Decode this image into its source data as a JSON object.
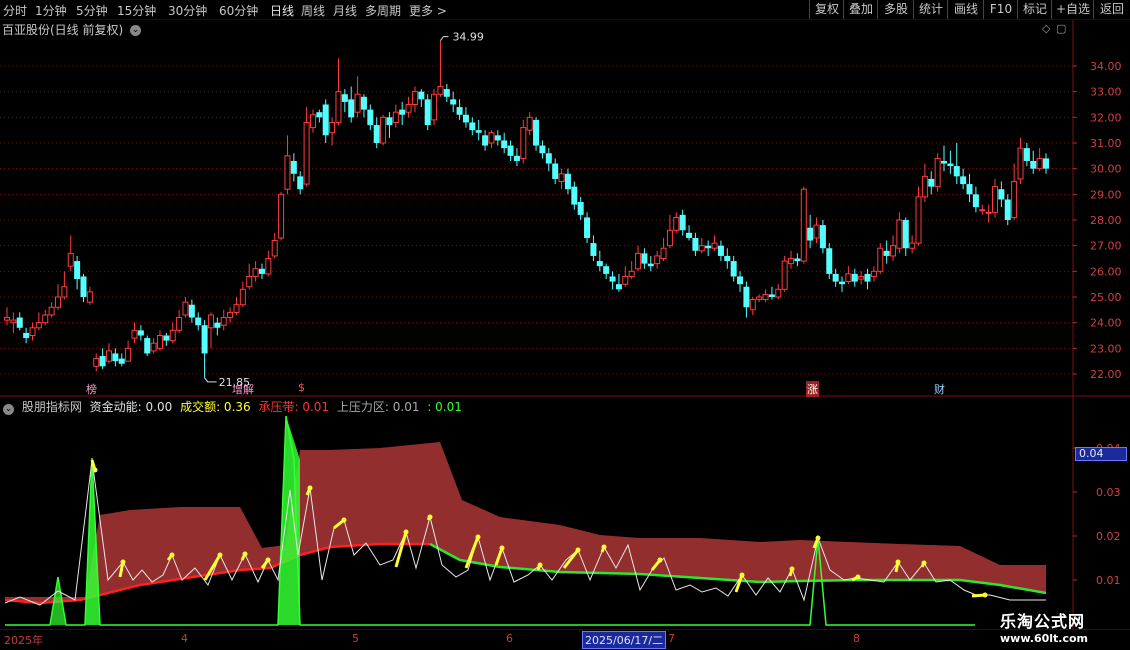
{
  "toolbar": {
    "periods": [
      "分时",
      "1分钟",
      "5分钟",
      "15分钟",
      "30分钟",
      "60分钟",
      "日线",
      "周线",
      "月线",
      "多周期",
      "更多 >"
    ],
    "active_period": "日线",
    "right_buttons": [
      "复权",
      "叠加",
      "多股",
      "统计",
      "画线",
      "F10",
      "标记",
      "+自选",
      "返回"
    ]
  },
  "chart_title": "百亚股份(日线 前复权)",
  "price_axis": {
    "ticks": [
      "34.00",
      "33.00",
      "32.00",
      "31.00",
      "30.00",
      "29.00",
      "28.00",
      "27.00",
      "26.00",
      "25.00",
      "24.00",
      "23.00",
      "22.00"
    ]
  },
  "annotations": {
    "high_label": "34.99",
    "low_label": "21.85"
  },
  "event_tags": [
    "榜",
    "增解",
    "$",
    "涨",
    "财"
  ],
  "indicator": {
    "name": "股朋指标网",
    "fund_label": "资金动能: 0.00",
    "volume_label": "成交额: 0.36",
    "pressure_band_label": "承压带: 0.01",
    "upper_zone_label": "上压力区: 0.01",
    "last_label": ": 0.01",
    "axis_ticks": [
      "0.04",
      "0.03",
      "0.02",
      "0.01"
    ],
    "current_value": "0.04"
  },
  "time_axis": {
    "labels": [
      "2025年",
      "4",
      "5",
      "6",
      "7",
      "8"
    ],
    "cursor_date": "2025/06/17/二"
  },
  "watermark": {
    "title": "乐淘公式网",
    "url": "www.60lt.com"
  },
  "colors": {
    "up": "#ff3c3c",
    "down": "#54ffff",
    "pressure_fill": "#9b3030",
    "support_line_red": "#ff2020",
    "support_line_green": "#2ee62e",
    "signal_yellow": "#ffff33",
    "spike_green": "#33ff33",
    "grid": "#7a1010"
  },
  "chart_data": {
    "type": "candlestick",
    "title": "百亚股份(日线 前复权)",
    "ylim": [
      21.6,
      35.2
    ],
    "high": 34.99,
    "low": 21.85,
    "candles": [
      [
        24.1,
        24.2,
        24.6,
        23.9
      ],
      [
        24.0,
        24.1,
        24.4,
        23.6
      ],
      [
        24.2,
        23.8,
        24.4,
        23.7
      ],
      [
        23.6,
        23.4,
        23.8,
        23.2
      ],
      [
        23.5,
        23.8,
        24.0,
        23.3
      ],
      [
        23.8,
        24.0,
        24.4,
        23.7
      ],
      [
        24.0,
        24.3,
        24.5,
        23.9
      ],
      [
        24.3,
        24.6,
        24.8,
        24.2
      ],
      [
        24.6,
        25.0,
        25.5,
        24.5
      ],
      [
        25.0,
        25.4,
        26.0,
        24.9
      ],
      [
        26.2,
        26.7,
        27.4,
        26.0
      ],
      [
        26.4,
        25.7,
        26.6,
        25.3
      ],
      [
        25.8,
        25.0,
        25.9,
        24.8
      ],
      [
        24.8,
        25.2,
        25.4,
        24.7
      ],
      [
        22.3,
        22.6,
        22.8,
        22.1
      ],
      [
        22.7,
        22.3,
        23.0,
        22.2
      ],
      [
        22.5,
        22.9,
        23.2,
        22.4
      ],
      [
        22.8,
        22.5,
        23.0,
        22.3
      ],
      [
        22.6,
        22.4,
        22.8,
        22.3
      ],
      [
        22.5,
        23.0,
        23.3,
        22.5
      ],
      [
        23.4,
        23.7,
        24.0,
        23.2
      ],
      [
        23.7,
        23.5,
        23.9,
        23.3
      ],
      [
        23.4,
        22.8,
        23.5,
        22.7
      ],
      [
        22.9,
        23.2,
        23.4,
        22.8
      ],
      [
        23.0,
        23.5,
        23.7,
        22.9
      ],
      [
        23.5,
        23.3,
        23.6,
        23.1
      ],
      [
        23.3,
        23.7,
        24.0,
        23.2
      ],
      [
        23.7,
        24.2,
        24.5,
        23.6
      ],
      [
        24.3,
        24.8,
        25.0,
        24.2
      ],
      [
        24.7,
        24.2,
        24.9,
        24.0
      ],
      [
        24.2,
        23.9,
        24.4,
        23.7
      ],
      [
        23.9,
        22.8,
        24.1,
        21.85
      ],
      [
        23.8,
        24.3,
        24.4,
        23.0
      ],
      [
        24.0,
        23.8,
        24.2,
        23.5
      ],
      [
        23.9,
        24.2,
        24.5,
        23.7
      ],
      [
        24.2,
        24.4,
        24.6,
        24.0
      ],
      [
        24.4,
        24.7,
        25.0,
        24.3
      ],
      [
        24.7,
        25.3,
        25.6,
        24.6
      ],
      [
        25.4,
        25.8,
        26.3,
        25.3
      ],
      [
        25.8,
        26.1,
        26.4,
        25.6
      ],
      [
        26.1,
        25.9,
        26.3,
        25.7
      ],
      [
        25.9,
        26.5,
        26.8,
        25.8
      ],
      [
        26.6,
        27.2,
        27.5,
        26.5
      ],
      [
        27.3,
        29.0,
        29.1,
        27.2
      ],
      [
        29.2,
        30.5,
        31.3,
        29.0
      ],
      [
        30.3,
        29.8,
        30.6,
        29.5
      ],
      [
        29.7,
        29.2,
        29.9,
        29.0
      ],
      [
        29.4,
        31.8,
        32.4,
        29.3
      ],
      [
        31.6,
        32.1,
        32.3,
        31.4
      ],
      [
        32.2,
        32.0,
        32.3,
        31.8
      ],
      [
        32.5,
        31.3,
        32.7,
        31.0
      ],
      [
        31.4,
        31.8,
        32.0,
        30.9
      ],
      [
        31.8,
        33.0,
        34.3,
        31.7
      ],
      [
        32.9,
        32.6,
        33.1,
        32.2
      ],
      [
        32.7,
        32.0,
        33.2,
        31.8
      ],
      [
        32.2,
        32.9,
        33.6,
        32.0
      ],
      [
        32.8,
        32.3,
        32.9,
        32.0
      ],
      [
        32.3,
        31.7,
        32.5,
        31.5
      ],
      [
        31.7,
        31.0,
        32.0,
        30.8
      ],
      [
        31.0,
        32.0,
        32.1,
        30.9
      ],
      [
        32.0,
        31.7,
        32.2,
        31.2
      ],
      [
        31.8,
        32.2,
        32.5,
        31.6
      ],
      [
        32.3,
        32.1,
        32.6,
        31.7
      ],
      [
        32.2,
        32.5,
        32.8,
        32.0
      ],
      [
        32.5,
        33.0,
        33.2,
        32.2
      ],
      [
        33.0,
        32.7,
        33.1,
        32.4
      ],
      [
        32.7,
        31.7,
        32.9,
        31.5
      ],
      [
        31.9,
        32.9,
        33.1,
        31.7
      ],
      [
        32.9,
        33.2,
        34.99,
        32.8
      ],
      [
        33.1,
        32.8,
        33.3,
        32.6
      ],
      [
        32.7,
        32.5,
        33.0,
        32.2
      ],
      [
        32.4,
        32.1,
        32.7,
        31.9
      ],
      [
        32.1,
        31.8,
        32.4,
        31.6
      ],
      [
        31.8,
        31.5,
        32.0,
        31.3
      ],
      [
        31.5,
        31.4,
        31.9,
        31.1
      ],
      [
        31.3,
        30.9,
        31.5,
        30.7
      ],
      [
        31.0,
        31.4,
        31.5,
        30.8
      ],
      [
        31.3,
        31.1,
        31.5,
        30.9
      ],
      [
        31.1,
        30.8,
        31.4,
        30.6
      ],
      [
        30.9,
        30.5,
        31.1,
        30.3
      ],
      [
        30.5,
        30.3,
        30.8,
        30.1
      ],
      [
        30.4,
        31.6,
        31.9,
        30.2
      ],
      [
        31.5,
        32.0,
        32.2,
        31.3
      ],
      [
        31.9,
        30.9,
        32.0,
        30.7
      ],
      [
        30.9,
        30.6,
        31.1,
        30.4
      ],
      [
        30.6,
        30.2,
        30.8,
        29.9
      ],
      [
        30.2,
        29.6,
        30.4,
        29.4
      ],
      [
        29.5,
        29.8,
        30.0,
        29.2
      ],
      [
        29.8,
        29.2,
        30.0,
        29.0
      ],
      [
        29.3,
        28.6,
        29.5,
        28.4
      ],
      [
        28.7,
        28.2,
        28.9,
        28.0
      ],
      [
        28.1,
        27.3,
        28.3,
        27.1
      ],
      [
        27.1,
        26.6,
        27.4,
        26.4
      ],
      [
        26.4,
        26.2,
        26.8,
        26.0
      ],
      [
        26.2,
        25.9,
        26.3,
        25.7
      ],
      [
        25.8,
        25.6,
        26.0,
        25.3
      ],
      [
        25.5,
        25.3,
        25.9,
        25.2
      ],
      [
        25.5,
        25.8,
        26.2,
        25.4
      ],
      [
        25.8,
        26.0,
        26.4,
        25.7
      ],
      [
        26.1,
        26.7,
        27.0,
        26.0
      ],
      [
        26.7,
        26.3,
        26.9,
        26.1
      ],
      [
        26.3,
        26.2,
        26.6,
        26.0
      ],
      [
        26.3,
        26.6,
        26.8,
        26.1
      ],
      [
        26.5,
        26.9,
        27.3,
        26.4
      ],
      [
        27.0,
        27.6,
        28.2,
        26.9
      ],
      [
        27.6,
        28.1,
        28.3,
        27.5
      ],
      [
        28.2,
        27.6,
        28.4,
        27.4
      ],
      [
        27.5,
        27.3,
        27.8,
        27.2
      ],
      [
        27.3,
        26.8,
        27.5,
        26.6
      ],
      [
        26.8,
        27.0,
        27.3,
        26.7
      ],
      [
        27.0,
        26.9,
        27.2,
        26.6
      ],
      [
        26.9,
        27.1,
        27.4,
        26.8
      ],
      [
        27.0,
        26.6,
        27.2,
        26.4
      ],
      [
        26.6,
        26.4,
        26.9,
        26.1
      ],
      [
        26.4,
        25.8,
        26.6,
        25.6
      ],
      [
        25.8,
        25.5,
        26.0,
        25.2
      ],
      [
        25.4,
        24.6,
        25.6,
        24.2
      ],
      [
        24.5,
        24.9,
        25.0,
        24.3
      ],
      [
        24.9,
        25.0,
        25.1,
        24.8
      ],
      [
        24.9,
        25.1,
        25.3,
        24.8
      ],
      [
        25.1,
        25.0,
        25.4,
        24.9
      ],
      [
        25.0,
        25.3,
        25.5,
        24.9
      ],
      [
        25.3,
        26.4,
        26.6,
        25.2
      ],
      [
        26.3,
        26.5,
        26.8,
        26.1
      ],
      [
        26.5,
        26.4,
        26.7,
        26.2
      ],
      [
        26.4,
        29.2,
        29.3,
        26.3
      ],
      [
        27.7,
        27.2,
        28.2,
        26.9
      ],
      [
        27.3,
        27.8,
        28.1,
        27.1
      ],
      [
        27.8,
        26.9,
        28.0,
        26.7
      ],
      [
        26.9,
        25.9,
        27.1,
        25.7
      ],
      [
        25.9,
        25.6,
        26.1,
        25.4
      ],
      [
        25.6,
        25.5,
        25.8,
        25.2
      ],
      [
        25.6,
        25.9,
        26.2,
        25.5
      ],
      [
        25.9,
        25.6,
        26.1,
        25.4
      ],
      [
        25.7,
        25.8,
        26.0,
        25.5
      ],
      [
        25.9,
        25.6,
        26.1,
        25.3
      ],
      [
        25.8,
        26.0,
        26.2,
        25.6
      ],
      [
        26.0,
        26.9,
        27.1,
        25.9
      ],
      [
        26.8,
        26.6,
        27.2,
        26.3
      ],
      [
        26.6,
        27.0,
        27.4,
        26.4
      ],
      [
        26.9,
        28.0,
        28.3,
        26.7
      ],
      [
        28.0,
        26.9,
        28.1,
        26.6
      ],
      [
        26.9,
        27.1,
        27.4,
        26.7
      ],
      [
        27.1,
        28.9,
        29.3,
        27.0
      ],
      [
        28.9,
        29.7,
        30.2,
        28.7
      ],
      [
        29.6,
        29.3,
        29.9,
        29.0
      ],
      [
        29.3,
        30.4,
        30.6,
        29.1
      ],
      [
        30.3,
        30.2,
        30.9,
        29.9
      ],
      [
        30.2,
        30.1,
        30.7,
        29.8
      ],
      [
        30.1,
        29.7,
        31.0,
        29.4
      ],
      [
        29.7,
        29.4,
        30.0,
        29.2
      ],
      [
        29.4,
        29.0,
        29.8,
        28.7
      ],
      [
        29.0,
        28.5,
        29.3,
        28.3
      ],
      [
        28.4,
        28.4,
        28.6,
        28.2
      ],
      [
        28.3,
        28.3,
        28.6,
        27.9
      ],
      [
        28.3,
        29.3,
        29.6,
        28.1
      ],
      [
        29.2,
        28.8,
        29.5,
        28.5
      ],
      [
        28.8,
        28.0,
        29.0,
        27.8
      ],
      [
        28.1,
        29.5,
        30.2,
        28.0
      ],
      [
        29.6,
        30.8,
        31.2,
        29.4
      ],
      [
        30.8,
        30.3,
        31.0,
        30.1
      ],
      [
        30.3,
        30.0,
        30.7,
        29.8
      ],
      [
        30.0,
        30.4,
        30.8,
        29.9
      ],
      [
        30.4,
        30.0,
        30.6,
        29.8
      ]
    ]
  }
}
